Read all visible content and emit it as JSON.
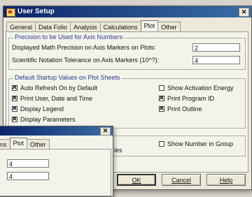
{
  "main_window": {
    "title": "User Setup",
    "close_label": "✕",
    "tabs": [
      "General",
      "Data Folio",
      "Analysis",
      "Calculations",
      "Plot",
      "Other"
    ],
    "active_tab": "Plot",
    "precision_group": {
      "title": "Precision to be Used for Axis Numbers",
      "rows": [
        {
          "label": "Displayed Math Precision on Axis Markers on Plots:",
          "value": "2"
        },
        {
          "label": "Scientific Notation Tolerance on Axis Markers (10^?):",
          "value": "4"
        }
      ]
    },
    "defaults_group": {
      "title": "Default Startup Values on Plot Sheets",
      "left_checks": [
        {
          "label": "Auto Refresh On by Default",
          "checked": true
        },
        {
          "label": "Print User, Date and Time",
          "checked": true
        },
        {
          "label": "Display Legend",
          "checked": true
        },
        {
          "label": "Display Parameters",
          "checked": true
        }
      ],
      "right_checks": [
        {
          "label": "Show Activation Energy",
          "checked": false
        },
        {
          "label": "Print Program ID",
          "checked": true
        },
        {
          "label": "Print Outline",
          "checked": true
        }
      ]
    },
    "lower_check": {
      "label": "Show Number in Group",
      "checked": false
    },
    "partial_text": "les",
    "buttons": {
      "ok": "OK",
      "cancel": "Cancel",
      "help": "Help"
    }
  },
  "back_window": {
    "close_label": "✕",
    "tabs": [
      "ns",
      "Plot",
      "Other"
    ],
    "fields": [
      "4",
      "4"
    ]
  }
}
